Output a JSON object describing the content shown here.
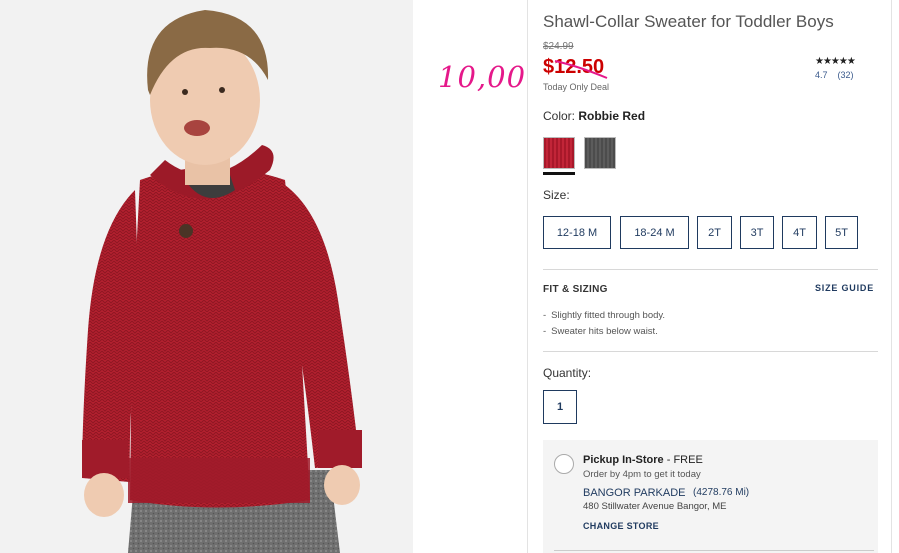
{
  "annotation": {
    "handwritten_price": "10,00"
  },
  "product": {
    "title": "Shawl-Collar Sweater for Toddler Boys",
    "price_original": "$24.99",
    "price_sale": "$12.50",
    "deal_label": "Today Only Deal",
    "rating_stars": "★★★★★",
    "rating_value": "4.7",
    "review_count": "(32)"
  },
  "color": {
    "label": "Color:",
    "selected": "Robbie Red",
    "swatches": [
      {
        "name": "Robbie Red",
        "hex": "#b81f31"
      },
      {
        "name": "Charcoal",
        "hex": "#555555"
      }
    ]
  },
  "size": {
    "label": "Size:",
    "options": [
      "12-18 M",
      "18-24 M",
      "2T",
      "3T",
      "4T",
      "5T"
    ]
  },
  "fit": {
    "title": "FIT & SIZING",
    "guide_link": "SIZE GUIDE",
    "notes": [
      "Slightly fitted through body.",
      "Sweater hits below waist."
    ]
  },
  "quantity": {
    "label": "Quantity:",
    "value": "1"
  },
  "pickup": {
    "title": "Pickup In-Store",
    "suffix": " - FREE",
    "subtitle": "Order by 4pm to get it today",
    "store_name": "BANGOR PARKADE",
    "store_distance": "(4278.76 Mi)",
    "store_address": "480 Stillwater Avenue Bangor, ME",
    "change_label": "CHANGE STORE"
  },
  "colors": {
    "accent": "#1f3a5f",
    "sale": "#cc0000",
    "annotation": "#e5188a"
  }
}
